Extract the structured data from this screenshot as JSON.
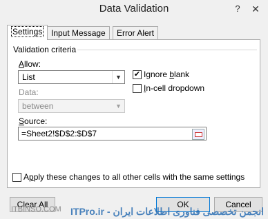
{
  "window": {
    "title": "Data Validation",
    "help": "?",
    "close": "✕"
  },
  "tabs": [
    {
      "label": "Settings",
      "active": true
    },
    {
      "label": "Input Message",
      "active": false
    },
    {
      "label": "Error Alert",
      "active": false
    }
  ],
  "criteria": {
    "legend": "Validation criteria",
    "allow_label_u": "A",
    "allow_label_rest": "llow:",
    "allow_value": "List",
    "data_label": "Data:",
    "data_value": "between",
    "ignore_blank_u": "b",
    "ignore_blank_pre": "Ignore ",
    "ignore_blank_post": "lank",
    "ignore_blank_checked": true,
    "incell_u": "I",
    "incell_rest": "n-cell dropdown",
    "incell_checked": false,
    "source_label_u": "S",
    "source_label_rest": "ource:",
    "source_value": "=Sheet2!$D$2:$D$7"
  },
  "apply_all": {
    "pre": "A",
    "u": "p",
    "rest": "ply these changes to all other cells with the same settings",
    "checked": false
  },
  "buttons": {
    "clear_all": "Clear All",
    "ok": "OK",
    "cancel": "Cancel"
  },
  "watermark": {
    "left": "ITBINSO.COM",
    "right": "ITPro.ir - انجمن تخصصی فناوری اطلاعات ایران"
  }
}
